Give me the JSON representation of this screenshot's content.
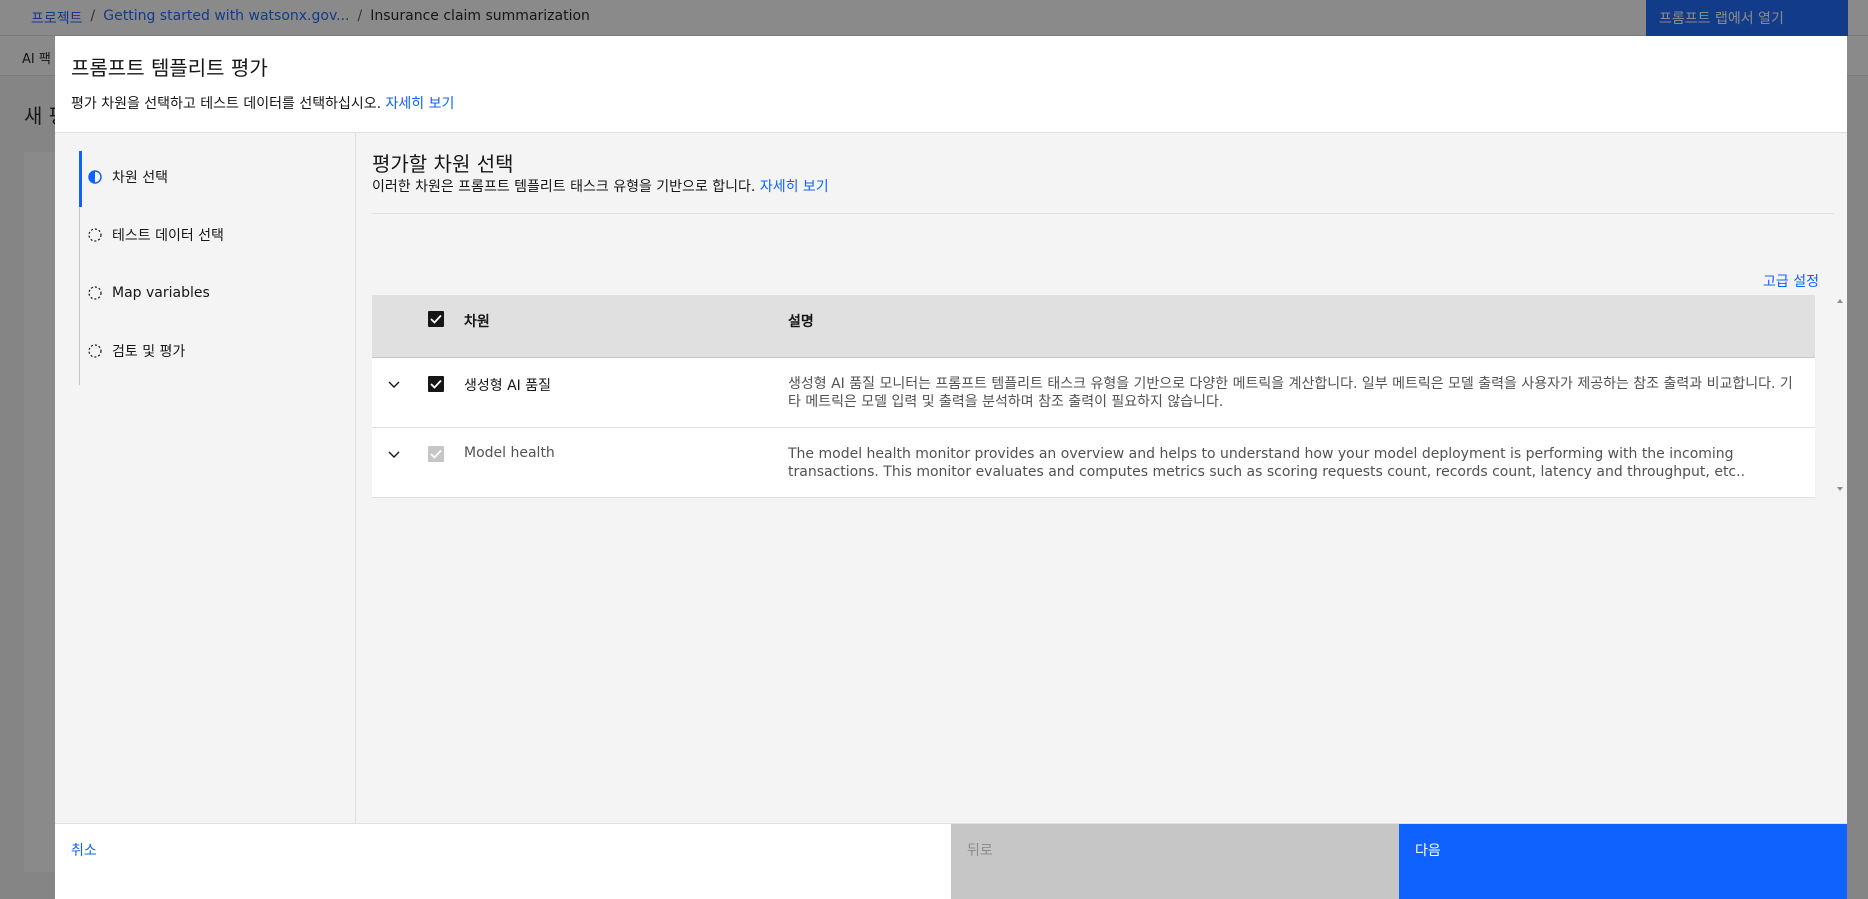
{
  "background": {
    "breadcrumb": [
      "프로젝트",
      "Getting started with watsonx.gov...",
      "Insurance claim summarization"
    ],
    "open_button": "프롬프트 랩에서 열기",
    "subbar_text": "AI 팩",
    "page_title": "새 평"
  },
  "modal": {
    "title": "프롬프트 템플리트 평가",
    "description": "평가 차원을 선택하고 테스트 데이터를 선택하십시오.",
    "learn_more": "자세히 보기"
  },
  "steps": [
    {
      "label": "차원 선택",
      "state": "active"
    },
    {
      "label": "테스트 데이터 선택",
      "state": "incomplete"
    },
    {
      "label": "Map variables",
      "state": "incomplete"
    },
    {
      "label": "검토 및 평가",
      "state": "incomplete"
    }
  ],
  "content": {
    "title": "평가할 차원 선택",
    "subtitle": "이러한 차원은 프롬프트 템플리트 태스크 유형을 기반으로 합니다.",
    "learn_more": "자세히 보기",
    "advanced": "고급 설정"
  },
  "table": {
    "headers": [
      "차원",
      "설명"
    ],
    "rows": [
      {
        "name": "생성형 AI 품질",
        "description": "생성형 AI 품질 모니터는 프롬프트 템플리트 태스크 유형을 기반으로 다양한 메트릭을 계산합니다. 일부 메트릭은 모델 출력을 사용자가 제공하는 참조 출력과 비교합니다. 기타 메트릭은 모델 입력 및 출력을 분석하며 참조 출력이 필요하지 않습니다.",
        "checked": true,
        "disabled": false
      },
      {
        "name": "Model health",
        "description": "The model health monitor provides an overview and helps to understand how your model deployment is performing with the incoming transactions. This monitor evaluates and computes metrics such as scoring requests count, records count, latency and throughput, etc..",
        "checked": true,
        "disabled": true
      }
    ]
  },
  "footer": {
    "cancel": "취소",
    "back": "뒤로",
    "next": "다음"
  },
  "colors": {
    "primary": "#0f62fe",
    "text": "#161616",
    "disabled": "#c6c6c6"
  }
}
